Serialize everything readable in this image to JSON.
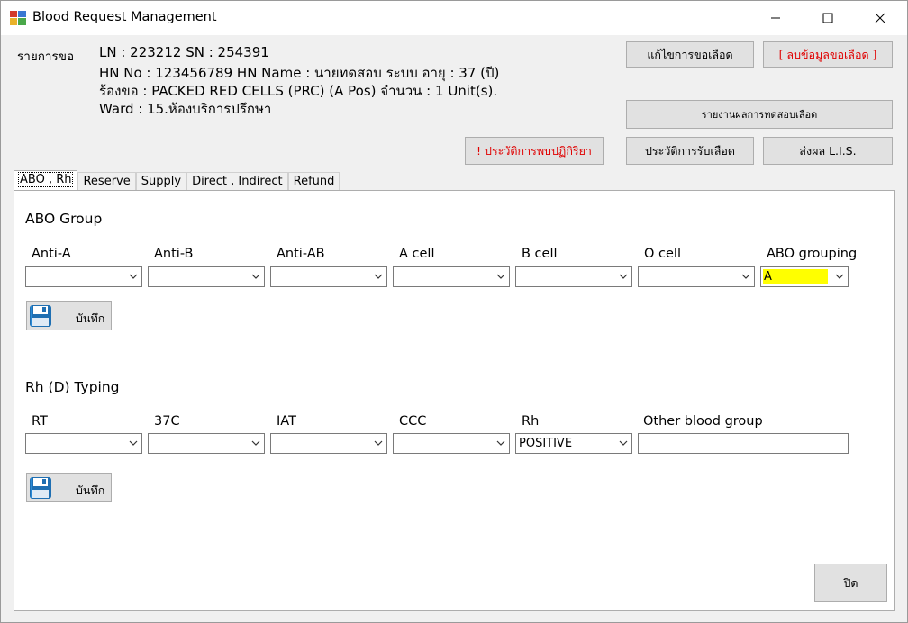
{
  "window": {
    "title": "Blood Request Management",
    "minimize_glyph": "—",
    "maximize_glyph": "☐",
    "close_glyph": "✕"
  },
  "request": {
    "label": "รายการขอ",
    "line1": "LN : 223212   SN : 254391",
    "line2": "HN No : 123456789    HN Name : นายทดสอบ  ระบบ     อายุ : 37 (ปี)",
    "line3": "ร้องขอ : PACKED RED CELLS (PRC)     (A Pos)     จำนวน : 1 Unit(s).",
    "line4": "Ward : 15.ห้องบริการปรึกษา"
  },
  "buttons": {
    "edit_request": "แก้ไขการขอเลือด",
    "delete_request": "[ ลบข้อมูลขอเลือด ]",
    "test_report": "รายงานผลการทดสอบเลือด",
    "reaction_history": "! ประวัติการพบปฏิกิริยา",
    "receive_history": "ประวัติการรับเลือด",
    "send_lis": "ส่งผล L.I.S.",
    "close": "ปิด"
  },
  "tabs": [
    {
      "label": "ABO , Rh",
      "active": true
    },
    {
      "label": "Reserve",
      "active": false
    },
    {
      "label": "Supply",
      "active": false
    },
    {
      "label": "Direct , Indirect",
      "active": false
    },
    {
      "label": "Refund",
      "active": false
    }
  ],
  "abo": {
    "title": "ABO Group",
    "columns": [
      {
        "label": "Anti-A",
        "value": ""
      },
      {
        "label": "Anti-B",
        "value": ""
      },
      {
        "label": "Anti-AB",
        "value": ""
      },
      {
        "label": "A cell",
        "value": ""
      },
      {
        "label": "B cell",
        "value": ""
      },
      {
        "label": "O cell",
        "value": ""
      },
      {
        "label": "ABO grouping",
        "value": "A"
      }
    ],
    "save_label": "บันทึก"
  },
  "rh": {
    "title": "Rh (D) Typing",
    "columns": [
      {
        "label": "RT",
        "value": ""
      },
      {
        "label": "37C",
        "value": ""
      },
      {
        "label": "IAT",
        "value": ""
      },
      {
        "label": "CCC",
        "value": ""
      },
      {
        "label": "Rh",
        "value": "POSITIVE"
      }
    ],
    "other_label": "Other blood group",
    "other_value": "",
    "save_label": "บันทึก"
  },
  "colors": {
    "highlight": "#ffff00",
    "warning_text": "#e00000"
  },
  "icons": {
    "app": "app-icon",
    "save": "floppy-disk-icon",
    "dropdown": "chevron-down-icon"
  }
}
